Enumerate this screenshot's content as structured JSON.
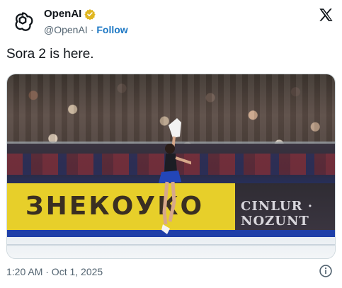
{
  "account": {
    "name": "OpenAI",
    "handle": "@OpenAI",
    "separator": "·",
    "follow_label": "Follow",
    "verified_color": "#e0b620"
  },
  "icons": {
    "avatar": "openai-logo-icon",
    "badge": "verified-badge-icon",
    "platform": "x-logo-icon",
    "info": "info-icon"
  },
  "tweet": {
    "text": "Sora 2 is here."
  },
  "media": {
    "board_left_text": "ЗНЕКОУКО",
    "board_right_text": "CINLUR · NOZUNT"
  },
  "meta": {
    "timestamp": "1:20 AM · Oct 1, 2025"
  },
  "colors": {
    "link": "#1d78c4",
    "muted": "#536471",
    "text": "#0f1419"
  }
}
